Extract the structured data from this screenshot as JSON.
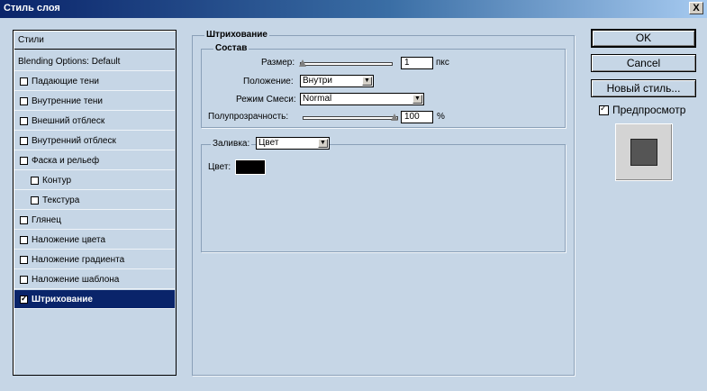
{
  "window": {
    "title": "Стиль слоя",
    "close_label": "X"
  },
  "style_list": {
    "items": [
      {
        "label": "Стили",
        "checkbox": false,
        "checked": false,
        "indent": false,
        "selected": false
      },
      {
        "label": "Blending Options: Default",
        "checkbox": false,
        "checked": false,
        "indent": false,
        "selected": false
      },
      {
        "label": "Падающие тени",
        "checkbox": true,
        "checked": false,
        "indent": false,
        "selected": false
      },
      {
        "label": "Внутренние тени",
        "checkbox": true,
        "checked": false,
        "indent": false,
        "selected": false
      },
      {
        "label": "Внешний отблеск",
        "checkbox": true,
        "checked": false,
        "indent": false,
        "selected": false
      },
      {
        "label": "Внутренний отблеск",
        "checkbox": true,
        "checked": false,
        "indent": false,
        "selected": false
      },
      {
        "label": "Фаска и рельеф",
        "checkbox": true,
        "checked": false,
        "indent": false,
        "selected": false
      },
      {
        "label": "Контур",
        "checkbox": true,
        "checked": false,
        "indent": true,
        "selected": false
      },
      {
        "label": "Текстура",
        "checkbox": true,
        "checked": false,
        "indent": true,
        "selected": false
      },
      {
        "label": "Глянец",
        "checkbox": true,
        "checked": false,
        "indent": false,
        "selected": false
      },
      {
        "label": "Наложение цвета",
        "checkbox": true,
        "checked": false,
        "indent": false,
        "selected": false
      },
      {
        "label": "Наложение градиента",
        "checkbox": true,
        "checked": false,
        "indent": false,
        "selected": false
      },
      {
        "label": "Наложение шаблона",
        "checkbox": true,
        "checked": false,
        "indent": false,
        "selected": false
      },
      {
        "label": "Штрихование",
        "checkbox": true,
        "checked": true,
        "indent": false,
        "selected": true
      }
    ]
  },
  "stroke": {
    "group_title": "Штрихование",
    "structure_title": "Состав",
    "size_label": "Размер:",
    "size_value": "1",
    "size_unit": "пкс",
    "size_level": 0.0,
    "position_label": "Положение:",
    "position_value": "Внутри",
    "blend_label": "Режим Смеси:",
    "blend_value": "Normal",
    "opacity_label": "Полупрозрачность:",
    "opacity_value": "100",
    "opacity_unit": "%",
    "opacity_level": 1.0,
    "fill_label": "Заливка:",
    "fill_value": "Цвет",
    "color_label": "Цвет:",
    "color_value": "#000000"
  },
  "buttons": {
    "ok": "OK",
    "cancel": "Cancel",
    "new_style": "Новый стиль...",
    "preview_label": "Предпросмотр",
    "preview_checked": true
  }
}
